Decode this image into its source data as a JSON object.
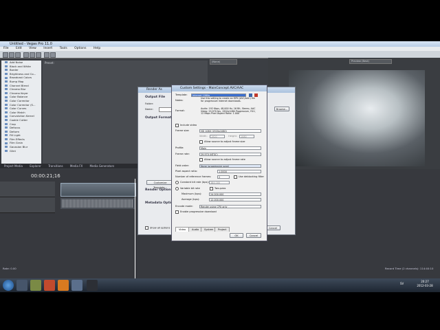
{
  "app": {
    "title": "Untitled - Vegas Pro 11.0",
    "menu": [
      "File",
      "Edit",
      "View",
      "Insert",
      "Tools",
      "Options",
      "Help"
    ],
    "preset_label": "Preset:",
    "timecode": "00:00:21;16",
    "preview_label": "Preview (Best)",
    "preview_dropdown": "(None)",
    "fx_items": [
      "Add Noise",
      "Black and White",
      "Border",
      "Brightness and Co...",
      "Broadcast Colors",
      "Bump Map",
      "Channel Blend",
      "Chroma Blur",
      "Chroma Keyer",
      "Color Balance",
      "Color Corrector",
      "Color Corrector (S...",
      "Color Curves",
      "Color Match",
      "Convolution Kernel",
      "Cookie Cutter",
      "Crop",
      "Defocus",
      "Deform",
      "Fill Light",
      "Film Effects",
      "Film Grain",
      "Gaussian Blur",
      "Glint"
    ],
    "tabs": [
      "Project Media",
      "Explorer",
      "Transitions",
      "Media FX",
      "Media Generators"
    ],
    "status": "Record Time (2 channels): 114:40:10",
    "rate": "Rate: 0.00"
  },
  "render_as": {
    "title": "Render As",
    "sections": [
      "Output File",
      "Output Format",
      "Render Options",
      "Metadata Options"
    ],
    "folder_label": "Folder:",
    "name_label": "Name:",
    "browse_label": "Browse...",
    "customize_label": "Customize Template...",
    "about_label": "About...",
    "render_label": "Render",
    "cancel_label": "Cancel",
    "show_all_label": "Show all options"
  },
  "custom_settings": {
    "title": "Custom Settings - MainConcept AVC/AAC",
    "template_label": "Template:",
    "template_value": "Internet 1080p",
    "notes_label": "Notes:",
    "notes_text": "Use this setting to create an MP4 (AVC/AAC) file for progressive Internet downloads.",
    "format_label": "Format:",
    "format_text": "Audio: 192 Kbps, 48,000 Hz, 16 Bit, Stereo, AAC Video: 29.970 fps, 1920x1080 Progressive, YUV, 12 Mbps Pixel Aspect Ratio: 1.000",
    "include_video": "Include video",
    "frame_size_label": "Frame size:",
    "frame_size_value": "HD 1080 (1920x1080)",
    "width_label": "Width:",
    "width_value": "1920",
    "height_label": "Height:",
    "height_value": "1080",
    "allow_source_frame": "Allow source to adjust frame size",
    "profile_label": "Profile:",
    "profile_value": "Main",
    "frame_rate_label": "Frame rate:",
    "frame_rate_value": "29.970 (NTSC)",
    "allow_source_rate": "Allow source to adjust frame rate",
    "field_order_label": "Field order:",
    "field_order_value": "None (progressive scan)",
    "pixel_aspect_label": "Pixel aspect ratio:",
    "pixel_aspect_value": "1.0000",
    "ref_frames_label": "Number of reference frames:",
    "ref_frames_value": "2",
    "deblock_label": "Use deblocking filter",
    "constant_bitrate": "Constant bit rate (bps):",
    "constant_value": "384,000",
    "variable_bitrate": "Variable bit rate",
    "two_pass": "Two-pass",
    "maximum_label": "Maximum (bps):",
    "maximum_value": "24,000,000",
    "average_label": "Average (bps):",
    "average_value": "12,000,000",
    "encode_mode_label": "Encode mode:",
    "encode_mode_value": "Render using CPU only",
    "progressive_download": "Enable progressive download",
    "tabs": [
      "Video",
      "Audio",
      "System",
      "Project"
    ],
    "ok_label": "OK",
    "cancel_label": "Cancel"
  },
  "taskbar": {
    "time": "20:27",
    "date": "2012-03-28",
    "lang": "SV"
  }
}
